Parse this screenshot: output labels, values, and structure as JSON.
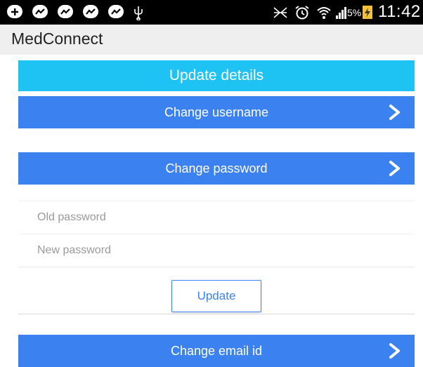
{
  "status_bar": {
    "icons": [
      "plus-box-icon",
      "chat-bubble-icon",
      "chat-bubble-icon",
      "chat-bubble-icon",
      "chat-bubble-icon",
      "usb-icon",
      "nfc-icon",
      "alarm-icon",
      "wifi-icon",
      "signal-icon",
      "charging-icon"
    ],
    "battery": "5%",
    "time": "11:42"
  },
  "app_bar": {
    "title": "MedConnect"
  },
  "header": {
    "title": "Update details"
  },
  "sections": {
    "username": {
      "label": "Change username"
    },
    "password": {
      "label": "Change password",
      "old_placeholder": "Old password",
      "new_placeholder": "New password",
      "old_value": "",
      "new_value": "",
      "update_label": "Update"
    },
    "email": {
      "label": "Change email id"
    }
  },
  "colors": {
    "status_bar": "#000000",
    "app_bar": "#efefef",
    "header": "#1ec2f3",
    "button": "#3b82f0",
    "button_text": "#ffffff"
  }
}
